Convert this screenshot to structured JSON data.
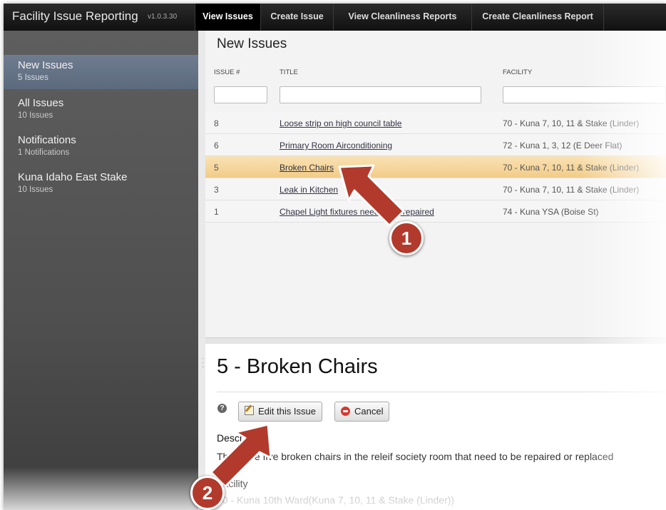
{
  "app": {
    "title": "Facility Issue Reporting",
    "version": "v1.0.3.30"
  },
  "nav_tabs": [
    {
      "label": "View Issues",
      "active": true
    },
    {
      "label": "Create Issue",
      "active": false
    },
    {
      "label": "View Cleanliness Reports",
      "active": false
    },
    {
      "label": "Create Cleanliness Report",
      "active": false
    }
  ],
  "sidebar": {
    "items": [
      {
        "label": "New Issues",
        "count": "5 Issues",
        "active": true
      },
      {
        "label": "All Issues",
        "count": "10 Issues",
        "active": false
      },
      {
        "label": "Notifications",
        "count": "1 Notifications",
        "active": false
      },
      {
        "label": "Kuna Idaho East Stake",
        "count": "10 Issues",
        "active": false
      }
    ]
  },
  "issues_list": {
    "title": "New Issues",
    "columns": [
      "ISSUE #",
      "TITLE",
      "FACILITY"
    ],
    "rows": [
      {
        "issue_no": "8",
        "title": "Loose strip on high council table",
        "facility": "70 - Kuna 7, 10, 11 & Stake (Linder)",
        "selected": false
      },
      {
        "issue_no": "6",
        "title": "Primary Room Airconditioning",
        "facility": "72 - Kuna 1, 3, 12 (E Deer Flat)",
        "selected": false
      },
      {
        "issue_no": "5",
        "title": "Broken Chairs",
        "facility": "70 - Kuna 7, 10, 11 & Stake (Linder)",
        "selected": true
      },
      {
        "issue_no": "3",
        "title": "Leak in Kitchen",
        "facility": "70 - Kuna 7, 10, 11 & Stake (Linder)",
        "selected": false
      },
      {
        "issue_no": "1",
        "title": "Chapel Light fixtures need to be repaired",
        "facility": "74 - Kuna YSA (Boise St)",
        "selected": false
      }
    ]
  },
  "detail": {
    "title": "5 - Broken Chairs",
    "edit_button": "Edit this Issue",
    "cancel_button": "Cancel",
    "description_label": "Description",
    "description_text": "There are five broken chairs in the releif society room that need to be repaired or replaced",
    "facility_label": "Facility",
    "facility_text": "70 - Kuna 10th Ward(Kuna 7, 10, 11 & Stake (Linder))"
  },
  "annotations": {
    "step1": "1",
    "step2": "2"
  },
  "colors": {
    "selected_row": "#f2cc88",
    "callout": "#b23a2c",
    "sidebar_active": "#6f7c8f"
  }
}
